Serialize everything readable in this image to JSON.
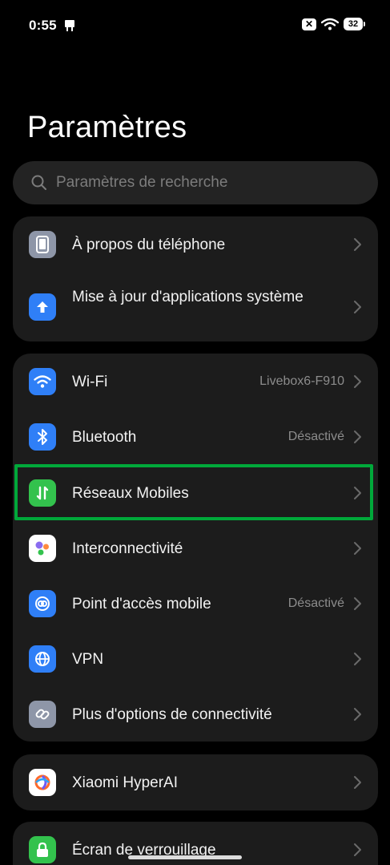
{
  "status_bar": {
    "time": "0:55",
    "battery": "32"
  },
  "title": "Paramètres",
  "search": {
    "placeholder": "Paramètres de recherche"
  },
  "card1": [
    {
      "label": "À propos du téléphone"
    },
    {
      "label": "Mise à jour d'applications système"
    }
  ],
  "card2": [
    {
      "label": "Wi-Fi",
      "value": "Livebox6-F910"
    },
    {
      "label": "Bluetooth",
      "value": "Désactivé"
    },
    {
      "label": "Réseaux Mobiles"
    },
    {
      "label": "Interconnectivité"
    },
    {
      "label": "Point d'accès mobile",
      "value": "Désactivé"
    },
    {
      "label": "VPN"
    },
    {
      "label": "Plus d'options de connectivité"
    }
  ],
  "card3": [
    {
      "label": "Xiaomi HyperAI"
    }
  ],
  "card4": [
    {
      "label": "Écran de verrouillage"
    }
  ],
  "colors": {
    "highlight": "#00a83a",
    "blue_icon": "#2f7ff7",
    "green_icon": "#33c24d",
    "gray_icon": "#8e96a8"
  }
}
